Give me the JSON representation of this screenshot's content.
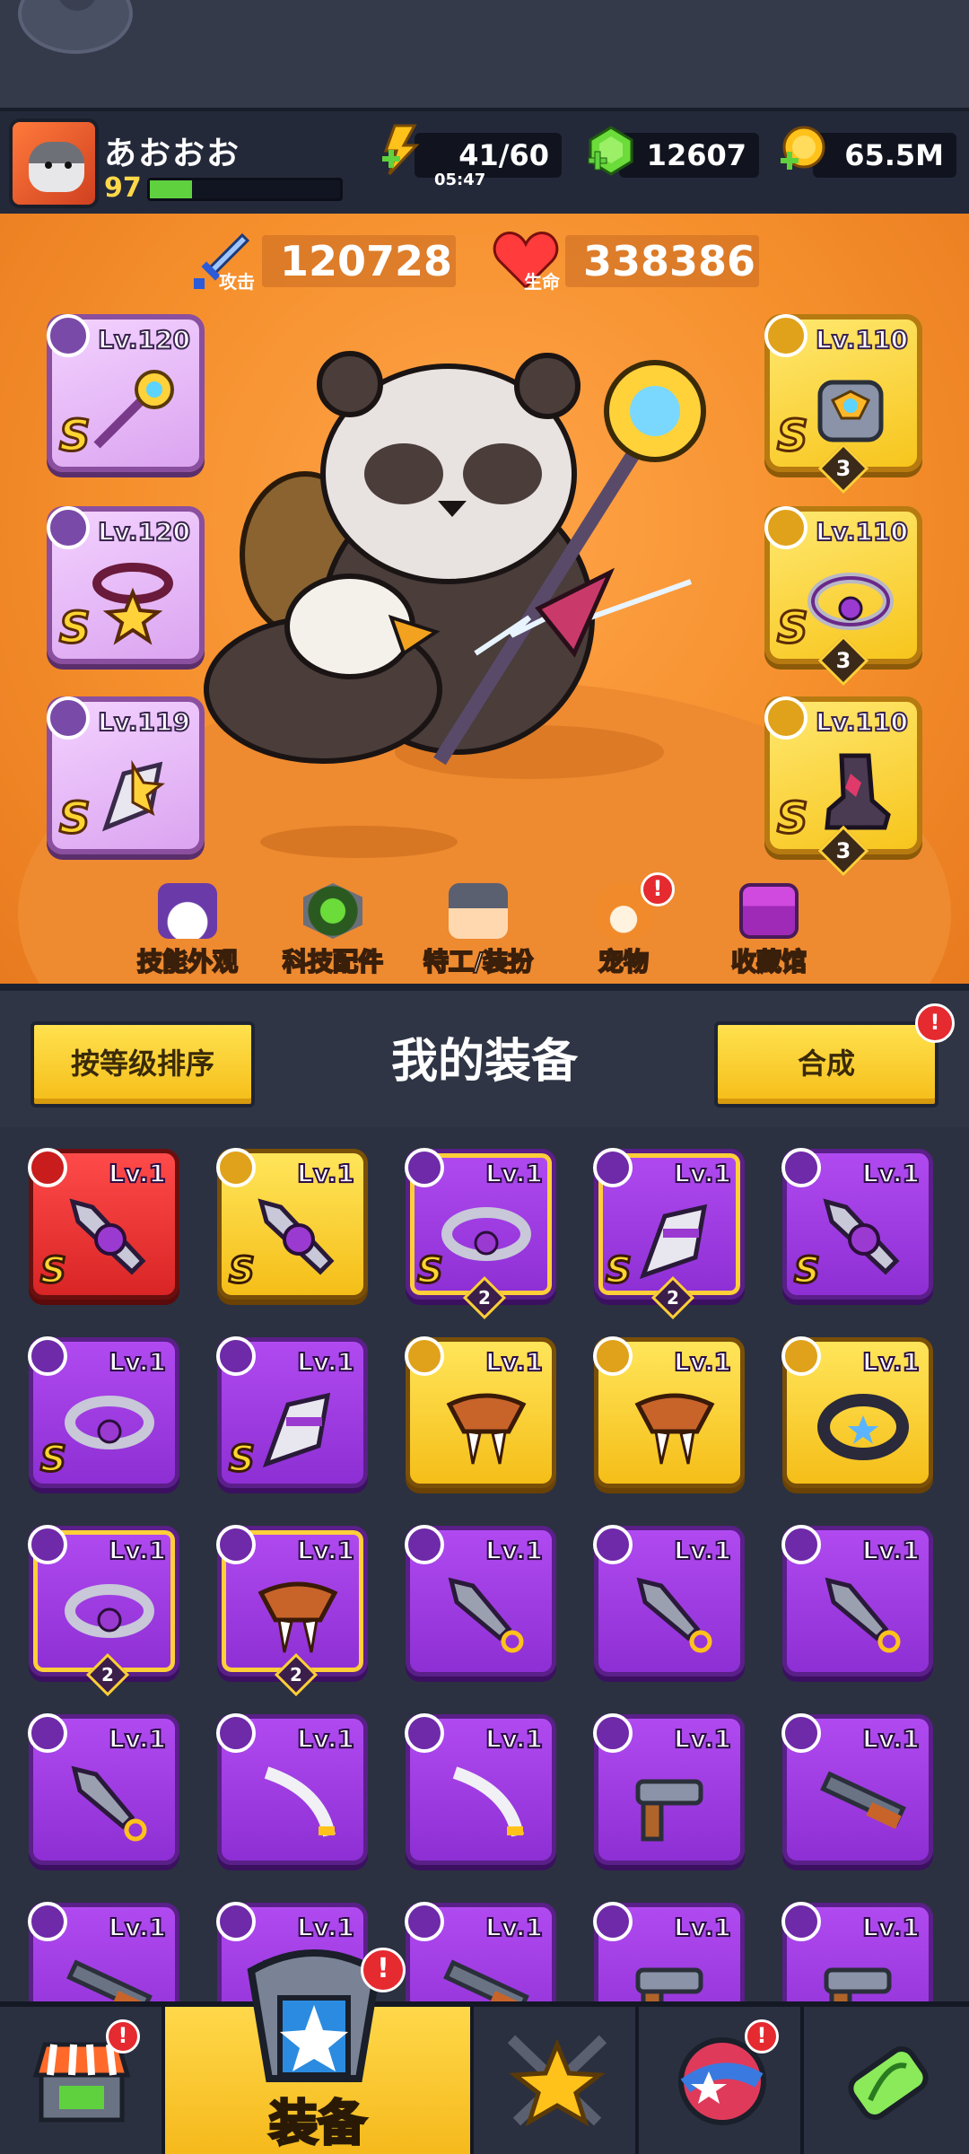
{
  "player": {
    "name": "あおおお",
    "level": "97",
    "xp_fraction": 0.22
  },
  "resources": {
    "energy": "41/60",
    "energy_timer": "05:47",
    "gems": "12607",
    "coins": "65.5M"
  },
  "stats": {
    "attack_value": "120728",
    "attack_label": "攻击",
    "hp_value": "338386",
    "hp_label": "生命"
  },
  "equipped_left": [
    {
      "level": "Lv.120",
      "rank": "S",
      "slot_type": "weapon-icon"
    },
    {
      "level": "Lv.120",
      "rank": "S",
      "slot_type": "necklace-icon"
    },
    {
      "level": "Lv.119",
      "rank": "S",
      "slot_type": "glove-icon"
    }
  ],
  "equipped_right": [
    {
      "level": "Lv.110",
      "rank": "S",
      "stars": "3",
      "slot_type": "armor-icon"
    },
    {
      "level": "Lv.110",
      "rank": "S",
      "stars": "3",
      "slot_type": "belt-icon"
    },
    {
      "level": "Lv.110",
      "rank": "S",
      "stars": "3",
      "slot_type": "boot-icon"
    }
  ],
  "hero_nav": [
    {
      "label": "技能外观",
      "badge": ""
    },
    {
      "label": "科技配件",
      "badge": ""
    },
    {
      "label": "特工/装扮",
      "badge": ""
    },
    {
      "label": "宠物",
      "badge": "!"
    },
    {
      "label": "收藏馆",
      "badge": ""
    }
  ],
  "equipment_bar": {
    "sort_label": "按等级排序",
    "title": "我的装备",
    "merge_label": "合成",
    "merge_badge": "!"
  },
  "inventory": [
    {
      "level": "Lv.1",
      "rank": "S",
      "stars": "",
      "style": "red"
    },
    {
      "level": "Lv.1",
      "rank": "S",
      "stars": "",
      "style": "gold"
    },
    {
      "level": "Lv.1",
      "rank": "S",
      "stars": "2",
      "style": "purple"
    },
    {
      "level": "Lv.1",
      "rank": "S",
      "stars": "2",
      "style": "purple"
    },
    {
      "level": "Lv.1",
      "rank": "S",
      "stars": "",
      "style": "purple"
    },
    {
      "level": "Lv.1",
      "rank": "S",
      "stars": "",
      "style": "purple"
    },
    {
      "level": "Lv.1",
      "rank": "S",
      "stars": "",
      "style": "purple"
    },
    {
      "level": "Lv.1",
      "rank": "",
      "stars": "",
      "style": "gold"
    },
    {
      "level": "Lv.1",
      "rank": "",
      "stars": "",
      "style": "gold"
    },
    {
      "level": "Lv.1",
      "rank": "",
      "stars": "",
      "style": "gold"
    },
    {
      "level": "Lv.1",
      "rank": "",
      "stars": "2",
      "style": "purple"
    },
    {
      "level": "Lv.1",
      "rank": "",
      "stars": "2",
      "style": "purple"
    },
    {
      "level": "Lv.1",
      "rank": "",
      "stars": "",
      "style": "purple"
    },
    {
      "level": "Lv.1",
      "rank": "",
      "stars": "",
      "style": "purple"
    },
    {
      "level": "Lv.1",
      "rank": "",
      "stars": "",
      "style": "purple"
    },
    {
      "level": "Lv.1",
      "rank": "",
      "stars": "",
      "style": "purple"
    },
    {
      "level": "Lv.1",
      "rank": "",
      "stars": "",
      "style": "purple"
    },
    {
      "level": "Lv.1",
      "rank": "",
      "stars": "",
      "style": "purple"
    },
    {
      "level": "Lv.1",
      "rank": "",
      "stars": "",
      "style": "purple"
    },
    {
      "level": "Lv.1",
      "rank": "",
      "stars": "",
      "style": "purple"
    },
    {
      "level": "Lv.1",
      "rank": "",
      "stars": "",
      "style": "purple"
    },
    {
      "level": "Lv.1",
      "rank": "",
      "stars": "",
      "style": "purple"
    },
    {
      "level": "Lv.1",
      "rank": "",
      "stars": "",
      "style": "purple"
    },
    {
      "level": "Lv.1",
      "rank": "",
      "stars": "",
      "style": "purple"
    },
    {
      "level": "Lv.1",
      "rank": "",
      "stars": "",
      "style": "purple"
    }
  ],
  "bottom_nav": {
    "equip_label": "装备",
    "shop_badge": "!",
    "equip_badge": "!",
    "planet_badge": "!"
  },
  "colors": {
    "purple_card": "#9b3ae0",
    "gold_card": "#f5be18",
    "red_card": "#e02a2a",
    "hero_bg": "#f58f2c"
  }
}
